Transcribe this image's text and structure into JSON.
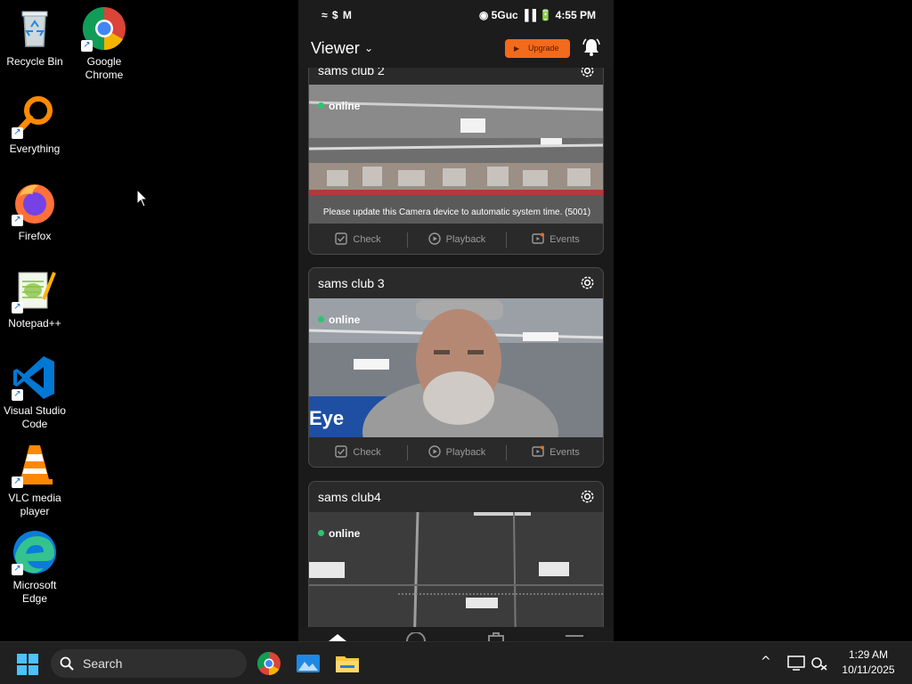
{
  "desktop": {
    "icons": [
      {
        "label": "Recycle Bin"
      },
      {
        "label": "Google Chrome"
      },
      {
        "label": "Everything"
      },
      {
        "label": "Firefox"
      },
      {
        "label": "Notepad++"
      },
      {
        "label": "Visual Studio Code"
      },
      {
        "label": "VLC media player"
      },
      {
        "label": "Microsoft Edge"
      }
    ]
  },
  "phone": {
    "status_bar": {
      "left": "≈ $ M",
      "right": "◉ 5Guc ▐▐ 🔋 4:55 PM"
    },
    "header": {
      "title": "Viewer",
      "chevron": "⌄",
      "upgrade_label": "Upgrade"
    },
    "cards": [
      {
        "title": "sams club 2",
        "status": "online",
        "notice": "Please update this Camera device to automatic system time. (5001)",
        "actions": [
          "Check",
          "Playback",
          "Events"
        ]
      },
      {
        "title": "sams club 3",
        "status": "online",
        "notice": "",
        "actions": [
          "Check",
          "Playback",
          "Events"
        ]
      },
      {
        "title": "sams club4",
        "status": "online",
        "notice": "",
        "actions": []
      }
    ],
    "feed_overlay_text": "Eye"
  },
  "taskbar": {
    "search_label": "Search",
    "tray_chevron": "^",
    "time": "1:29 AM",
    "date": "10/11/2025"
  },
  "colors": {
    "accent_orange": "#f26a1b",
    "online_green": "#28c76f",
    "taskbar": "#202020"
  }
}
